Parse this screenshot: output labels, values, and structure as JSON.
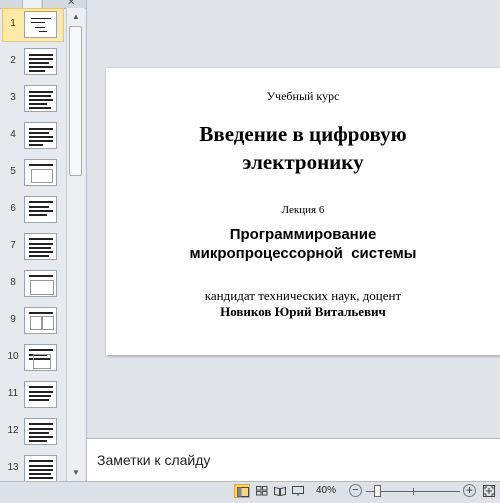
{
  "thumbnails": {
    "items": [
      {
        "number": "1",
        "selected": true
      },
      {
        "number": "2",
        "selected": false
      },
      {
        "number": "3",
        "selected": false
      },
      {
        "number": "4",
        "selected": false
      },
      {
        "number": "5",
        "selected": false
      },
      {
        "number": "6",
        "selected": false
      },
      {
        "number": "7",
        "selected": false
      },
      {
        "number": "8",
        "selected": false
      },
      {
        "number": "9",
        "selected": false
      },
      {
        "number": "10",
        "selected": false
      },
      {
        "number": "11",
        "selected": false
      },
      {
        "number": "12",
        "selected": false
      },
      {
        "number": "13",
        "selected": false
      }
    ]
  },
  "pane": {
    "close_glyph": "✕"
  },
  "slide": {
    "course": "Учебный курс",
    "title_line1": "Введение в цифровую",
    "title_line2": "электронику",
    "lecture": "Лекция 6",
    "topic_line1": "Программирование",
    "topic_line2": "микропроцессорной  системы",
    "degree": "кандидат технических наук, доцент",
    "author": "Новиков Юрий Витальевич"
  },
  "notes": {
    "placeholder": "Заметки к слайду"
  },
  "status_bar": {
    "zoom": "40%",
    "zoom_out": "−",
    "zoom_in": "+",
    "zoom_slider_fraction": 0.12,
    "active_view": "normal-view"
  },
  "scrollbar": {
    "up": "▲",
    "down": "▼"
  }
}
